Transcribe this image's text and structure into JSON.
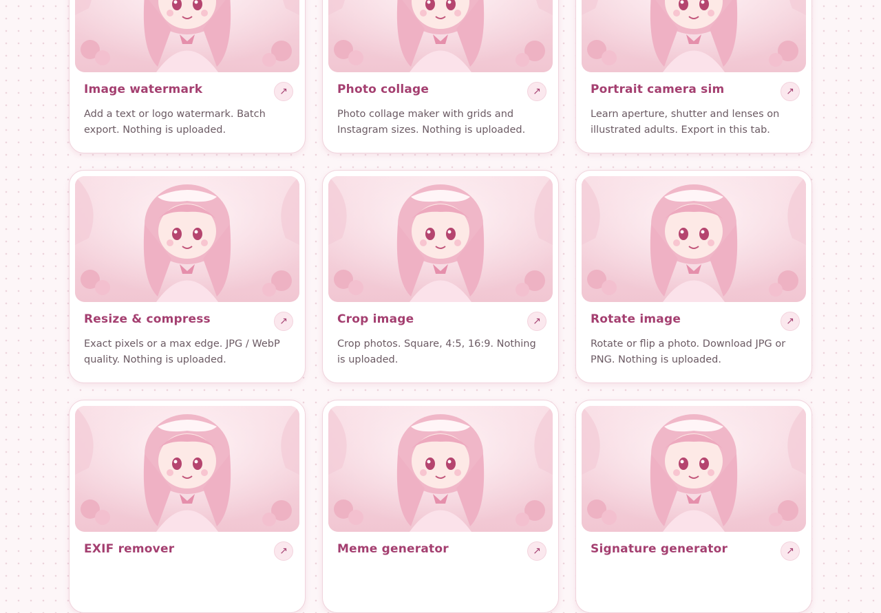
{
  "cards": [
    {
      "title": "Image watermark",
      "description": "Add a text or logo watermark. Batch export. Nothing is uploaded.",
      "arrow_icon": "arrow-up-right-icon"
    },
    {
      "title": "Photo collage",
      "description": "Photo collage maker with grids and Instagram sizes. Nothing is uploaded.",
      "arrow_icon": "arrow-up-right-icon"
    },
    {
      "title": "Portrait camera sim",
      "description": "Learn aperture, shutter and lenses on illustrated adults. Export in this tab.",
      "arrow_icon": "arrow-up-right-icon"
    },
    {
      "title": "Resize & compress",
      "description": "Exact pixels or a max edge. JPG / WebP quality. Nothing is uploaded.",
      "arrow_icon": "arrow-up-right-icon"
    },
    {
      "title": "Crop image",
      "description": "Crop photos. Square, 4:5, 16:9. Nothing is uploaded.",
      "arrow_icon": "arrow-up-right-icon"
    },
    {
      "title": "Rotate image",
      "description": "Rotate or flip a photo. Download JPG or PNG. Nothing is uploaded.",
      "arrow_icon": "arrow-up-right-icon"
    },
    {
      "title": "EXIF remover",
      "description": "",
      "arrow_icon": "arrow-up-right-icon"
    },
    {
      "title": "Meme generator",
      "description": "",
      "arrow_icon": "arrow-up-right-icon"
    },
    {
      "title": "Signature generator",
      "description": "",
      "arrow_icon": "arrow-up-right-icon"
    }
  ],
  "colors": {
    "accent": "#a43f70",
    "card_border": "#f0d3dc",
    "background": "#fdf6f8",
    "text_muted": "#6b5a63"
  }
}
